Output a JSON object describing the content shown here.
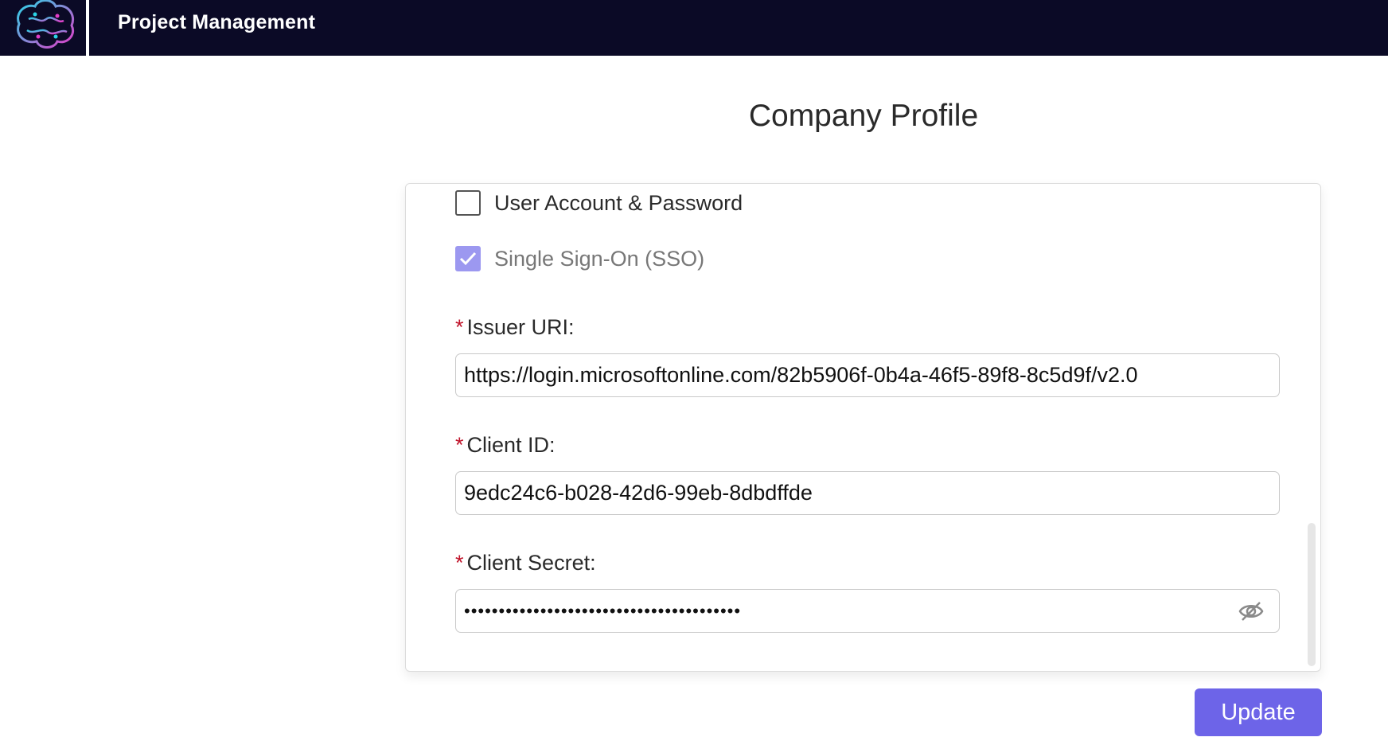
{
  "header": {
    "app_title": "Project Management",
    "logo_icon": "brain-logo-icon"
  },
  "page": {
    "title": "Company Profile"
  },
  "auth": {
    "options": [
      {
        "label": "User Account & Password",
        "checked": false
      },
      {
        "label": "Single Sign-On (SSO)",
        "checked": true,
        "disabled": true
      }
    ]
  },
  "sso": {
    "required_marker": "*",
    "issuer_uri": {
      "label": "Issuer URI:",
      "value": "https://login.microsoftonline.com/82b5906f-0b4a-46f5-89f8-8c5d9f/v2.0"
    },
    "client_id": {
      "label": "Client ID:",
      "value": "9edc24c6-b028-42d6-99eb-8dbdffde"
    },
    "client_secret": {
      "label": "Client Secret:",
      "masked_value": "••••••••••••••••••••••••••••••••••••••••",
      "toggle_icon": "eye-slash-icon"
    }
  },
  "actions": {
    "update_label": "Update"
  },
  "colors": {
    "topbar": "#0b0a26",
    "accent": "#6d64e8",
    "checkbox_checked": "#9c98f0",
    "required": "#c0132a"
  }
}
